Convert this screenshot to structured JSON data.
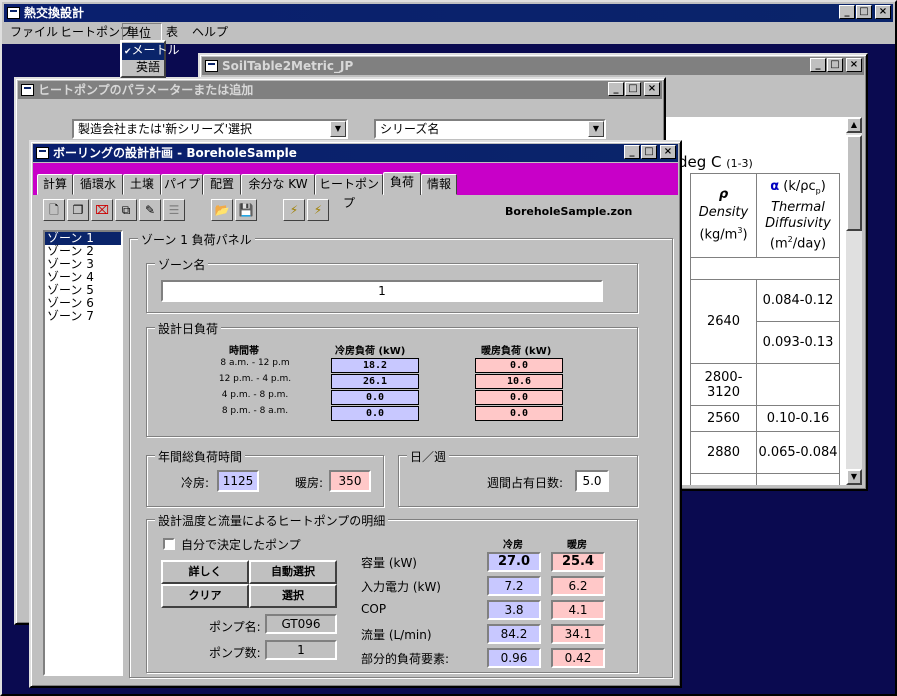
{
  "app": {
    "title": "熱交換設計"
  },
  "menubar": [
    "ファイル",
    "ヒートポンプ",
    "単位",
    "表",
    "ヘルプ"
  ],
  "units_menu": {
    "items": [
      {
        "label": "メートル",
        "checked": true
      },
      {
        "label": "英語",
        "checked": false
      }
    ]
  },
  "soil_window": {
    "title": "SoilTable2Metric_JP",
    "temp_header": "deg C",
    "temp_note": "(1-3)",
    "col_density": {
      "symbol": "ρ",
      "name": "Density",
      "unit": "(kg/m",
      "unit_exp": "3",
      "unit_close": ")"
    },
    "col_diff": {
      "symbol": "α",
      "formula": "(k/ρc",
      "formula_sub": "p",
      "formula_close": ")",
      "name1": "Thermal",
      "name2": "Diffusivity",
      "unit": "(m",
      "unit_exp": "2",
      "unit_close": "/day)"
    },
    "rows": [
      {
        "density": "2640",
        "diff": [
          "0.084-0.12",
          "0.093-0.13"
        ]
      },
      {
        "density": "2800-3120",
        "diff": [
          ""
        ]
      },
      {
        "density": "2560",
        "diff": [
          "0.10-0.16"
        ]
      },
      {
        "density": "2880",
        "diff": [
          "0.065-0.084"
        ]
      }
    ]
  },
  "heatpump_window": {
    "title": "ヒートポンプのパラメーターまたは追加",
    "manufacturer_combo": "製造会社または'新シリーズ'選択",
    "series_combo": "シリーズ名"
  },
  "borehole_window": {
    "title": "ボーリングの設計計画 - BoreholeSample",
    "tabs": [
      "計算",
      "循環水",
      "土壌",
      "パイプ",
      "配置",
      "余分な KW",
      "ヒートポンプ",
      "負荷",
      "情報"
    ],
    "active_tab": "負荷",
    "filename": "BoreholeSample.zon",
    "zones": [
      "ゾーン 1",
      "ゾーン 2",
      "ゾーン 3",
      "ゾーン 4",
      "ゾーン 5",
      "ゾーン 6",
      "ゾーン 7"
    ],
    "panel_title": "ゾーン 1 負荷パネル",
    "zone_name_group": "ゾーン名",
    "zone_name_value": "1",
    "design_load_group": "設計日負荷",
    "load_headers": {
      "time": "時間帯",
      "cool": "冷房負荷 (kW)",
      "heat": "暖房負荷 (kW)"
    },
    "load_rows": [
      {
        "time": "8 a.m. - 12 p.m",
        "cool": "18.2",
        "heat": "0.0"
      },
      {
        "time": "12 p.m. - 4 p.m.",
        "cool": "26.1",
        "heat": "10.6"
      },
      {
        "time": "4 p.m. - 8 p.m.",
        "cool": "0.0",
        "heat": "0.0"
      },
      {
        "time": "8 p.m. - 8 a.m.",
        "cool": "0.0",
        "heat": "0.0"
      }
    ],
    "annual_group": "年間総負荷時間",
    "cool_label": "冷房:",
    "cool_hours": "1125",
    "heat_label": "暖房:",
    "heat_hours": "350",
    "week_group": "日／週",
    "week_label": "週間占有日数:",
    "week_value": "5.0",
    "hp_group": "設計温度と流量によるヒートポンプの明細",
    "self_pump_label": "自分で決定したポンプ",
    "buttons": {
      "detail": "詳しく",
      "auto": "自動選択",
      "clear": "クリア",
      "select": "選択"
    },
    "pump_name_label": "ポンプ名:",
    "pump_name": "GT096",
    "pump_count_label": "ポンプ数:",
    "pump_count": "1",
    "spec_headers": {
      "cool": "冷房",
      "heat": "暖房"
    },
    "specs": [
      {
        "label": "容量 (kW)",
        "cool": "27.0",
        "heat": "25.4"
      },
      {
        "label": "入力電力 (kW)",
        "cool": "7.2",
        "heat": "6.2"
      },
      {
        "label": "COP",
        "cool": "3.8",
        "heat": "4.1"
      },
      {
        "label": "流量 (L/min)",
        "cool": "84.2",
        "heat": "34.1"
      },
      {
        "label": "部分的負荷要素:",
        "cool": "0.96",
        "heat": "0.42"
      }
    ]
  }
}
